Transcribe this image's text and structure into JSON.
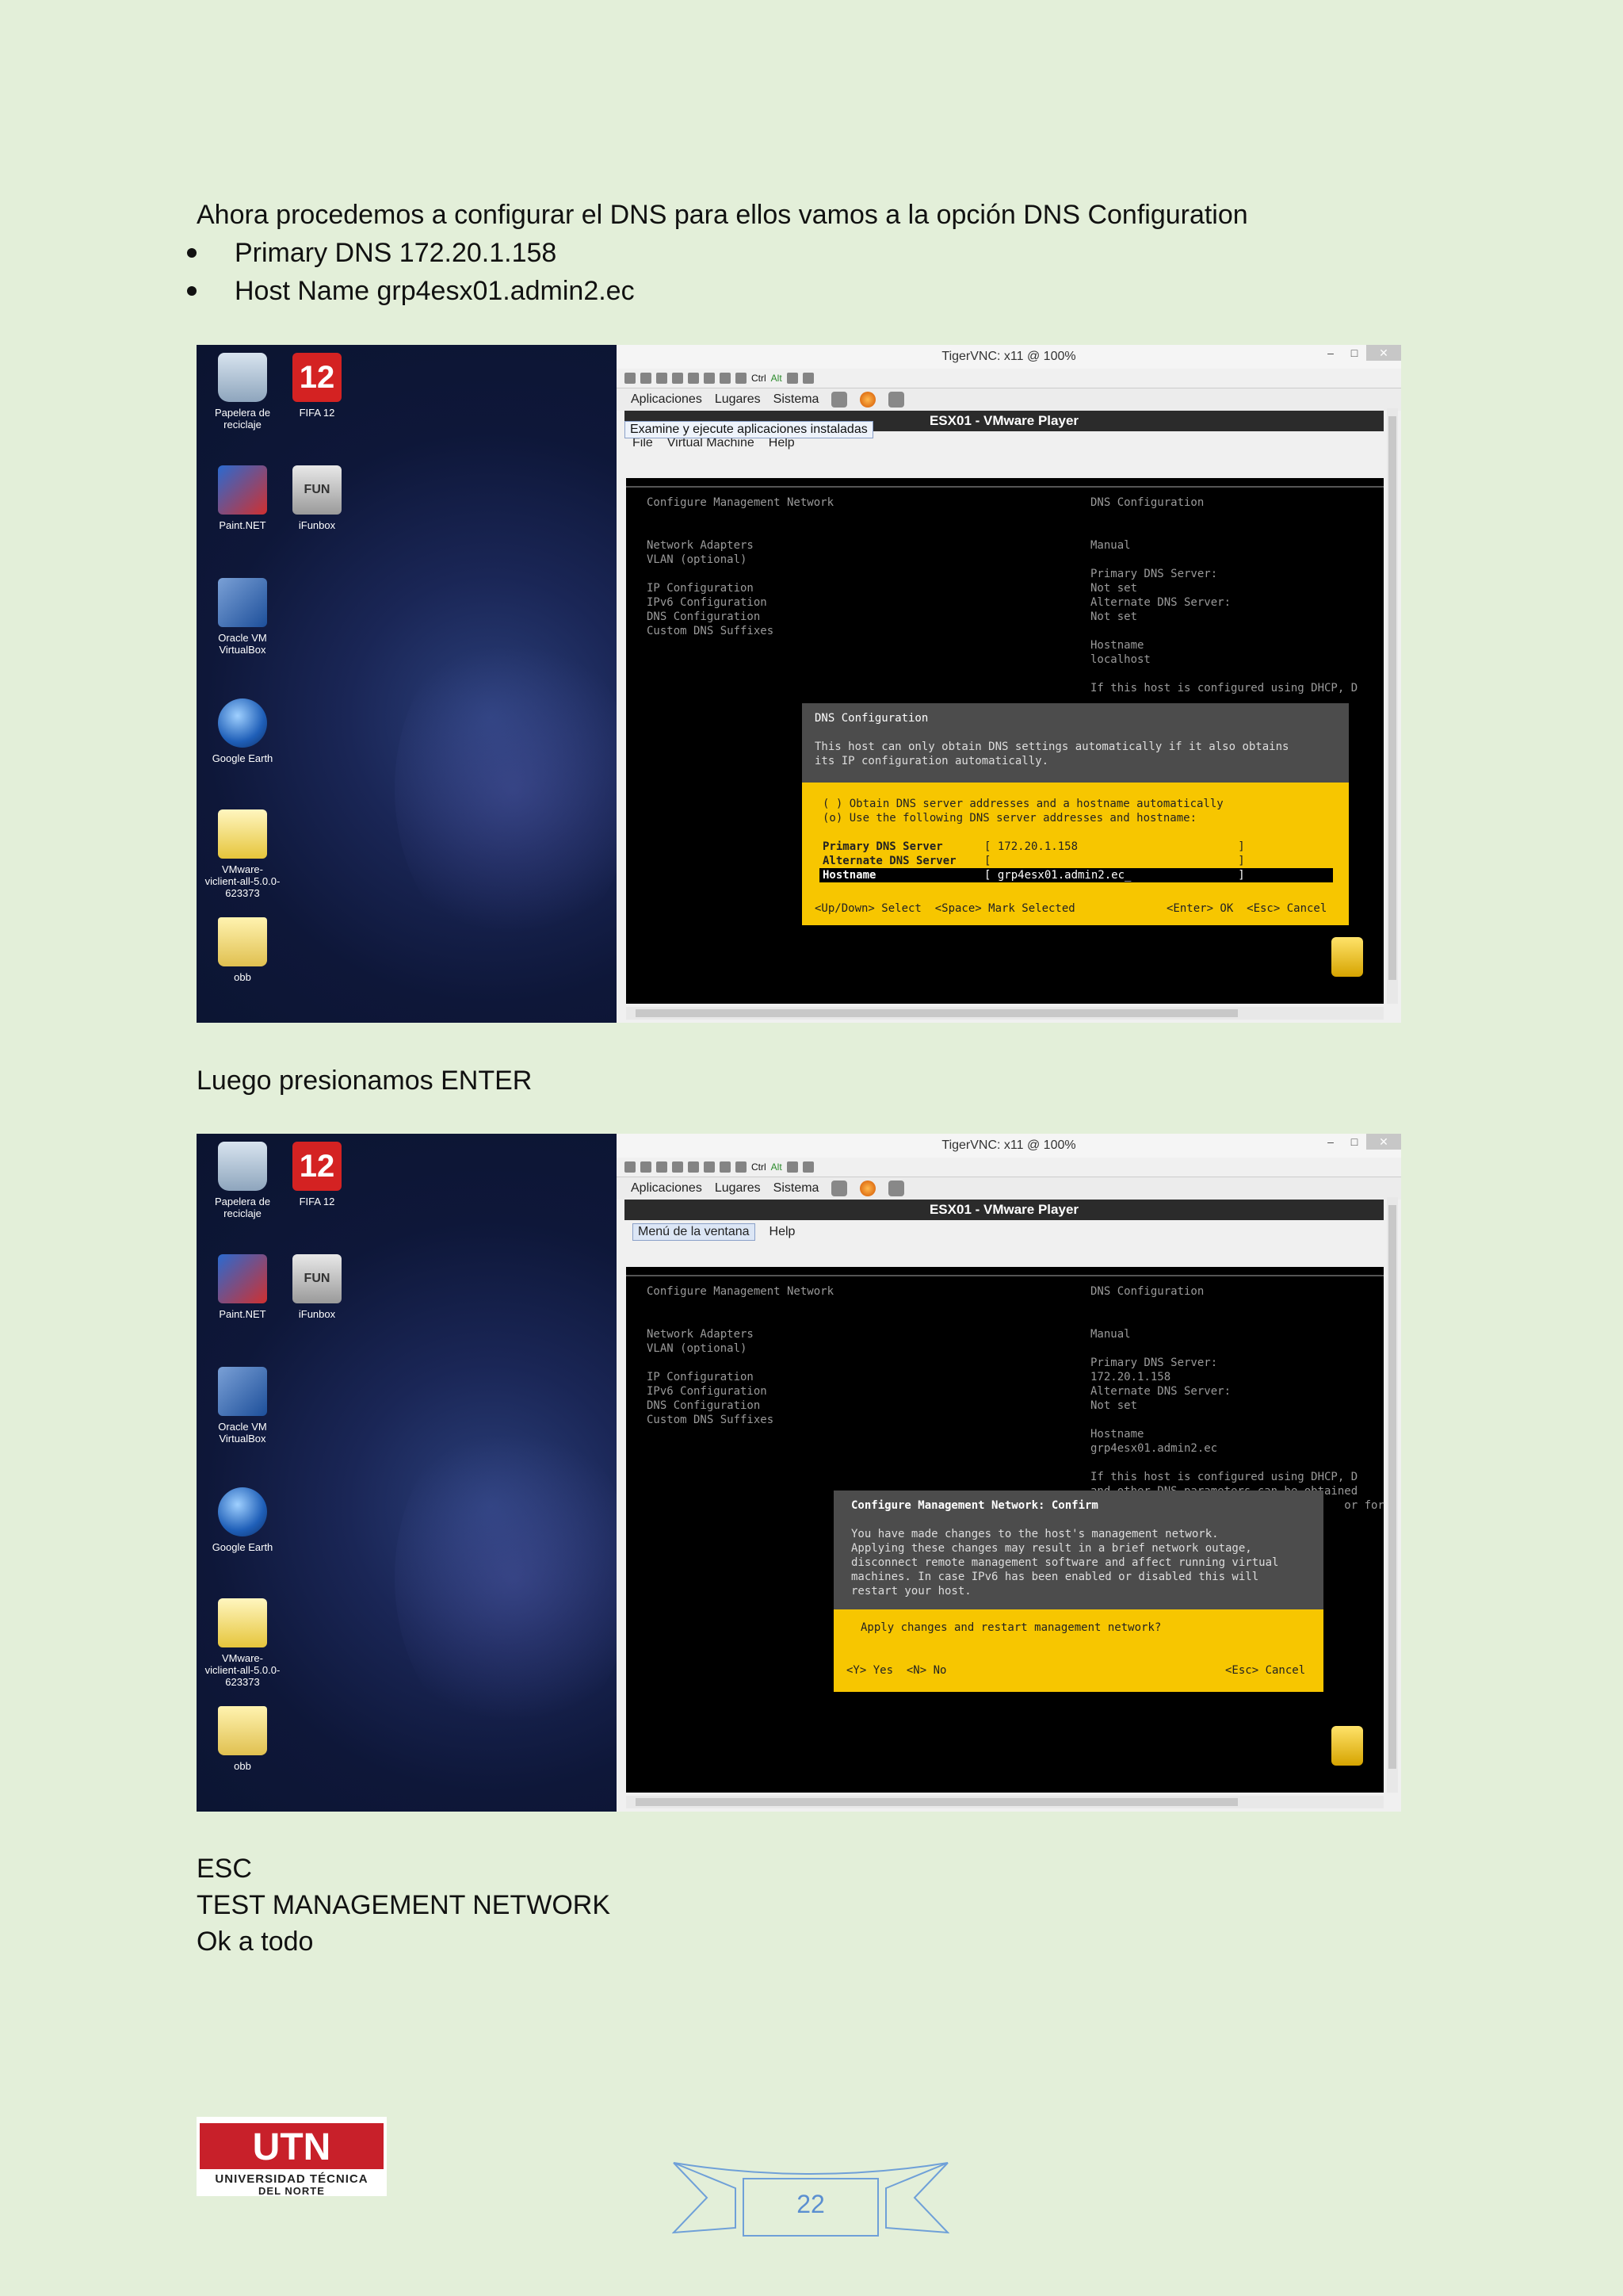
{
  "doc": {
    "intro": "Ahora procedemos a configurar el DNS para ellos vamos a la opción DNS Configuration",
    "bullets": [
      "Primary DNS 172.20.1.158",
      "Host Name grp4esx01.admin2.ec"
    ],
    "after_first": "Luego presionamos ENTER",
    "lines_end": [
      "ESC",
      "TEST MANAGEMENT NETWORK",
      "Ok a todo"
    ],
    "page_number": "22",
    "logo_line1": "UNIVERSIDAD TÉCNICA",
    "logo_line2": "DEL NORTE",
    "logo_mark": "UTN"
  },
  "desktop": {
    "icons": [
      "Papelera de reciclaje",
      "FIFA 12",
      "Paint.NET",
      "iFunbox",
      "Oracle VM VirtualBox",
      "Google Earth",
      "VMware-viclient-all-5.0.0-623373",
      "obb"
    ],
    "fifa_glyph": "12",
    "fun_glyph": "FUN"
  },
  "vnc": {
    "title": "TigerVNC: x11 @ 100%",
    "toolbar_ctrl": "Ctrl",
    "toolbar_alt": "Alt",
    "gnome_menu": [
      "Aplicaciones",
      "Lugares",
      "Sistema"
    ],
    "vmplayer_title": "ESX01 - VMware Player",
    "menu1": [
      "File",
      "Virtual Machine",
      "Help"
    ],
    "tooltip1": "Examine y ejecute aplicaciones instaladas",
    "menu2_highlight": "Menú de la ventana",
    "menu2_help": "Help"
  },
  "console1": {
    "header_left": "Configure Management Network",
    "header_right": "DNS Configuration",
    "left_items": [
      "Network Adapters",
      "VLAN (optional)",
      "",
      "IP Configuration",
      "IPv6 Configuration",
      "DNS Configuration",
      "Custom DNS Suffixes"
    ],
    "right_items": [
      "Manual",
      "",
      "Primary DNS Server:",
      "Not set",
      "Alternate DNS Server:",
      "Not set",
      "",
      "Hostname",
      "localhost",
      "",
      "If this host is configured using DHCP, D"
    ],
    "dialog_title": "DNS Configuration",
    "dialog_desc": [
      "This host can only obtain DNS settings automatically if it also obtains",
      "its IP configuration automatically."
    ],
    "opt1": "( ) Obtain DNS server addresses and a hostname automatically",
    "opt2": "(o) Use the following DNS server addresses and hostname:",
    "f1_label": "Primary DNS Server",
    "f1_value": "[ 172.20.1.158                        ]",
    "f2_label": "Alternate DNS Server",
    "f2_value": "[                                     ]",
    "f3_label": "Hostname",
    "f3_value": "[ grp4esx01.admin2.ec_                ]",
    "foot_left": "<Up/Down> Select  <Space> Mark Selected",
    "foot_right": "<Enter> OK  <Esc> Cancel"
  },
  "console2": {
    "header_left": "Configure Management Network",
    "header_right": "DNS Configuration",
    "left_items": [
      "Network Adapters",
      "VLAN (optional)",
      "",
      "IP Configuration",
      "IPv6 Configuration",
      "DNS Configuration",
      "Custom DNS Suffixes"
    ],
    "right_items": [
      "Manual",
      "",
      "Primary DNS Server:",
      "172.20.1.158",
      "Alternate DNS Server:",
      "Not set",
      "",
      "Hostname",
      "grp4esx01.admin2.ec",
      "",
      "If this host is configured using DHCP, D",
      "and other DNS parameters can be obtained",
      "                                      or for"
    ],
    "dialog_title": "Configure Management Network: Confirm",
    "dialog_desc": [
      "You have made changes to the host's management network.",
      "Applying these changes may result in a brief network outage,",
      "disconnect remote management software and affect running virtual",
      "machines. In case IPv6 has been enabled or disabled this will",
      "restart your host."
    ],
    "question": "Apply changes and restart management network?",
    "foot_left": "<Y> Yes  <N> No",
    "foot_right": "<Esc> Cancel"
  }
}
